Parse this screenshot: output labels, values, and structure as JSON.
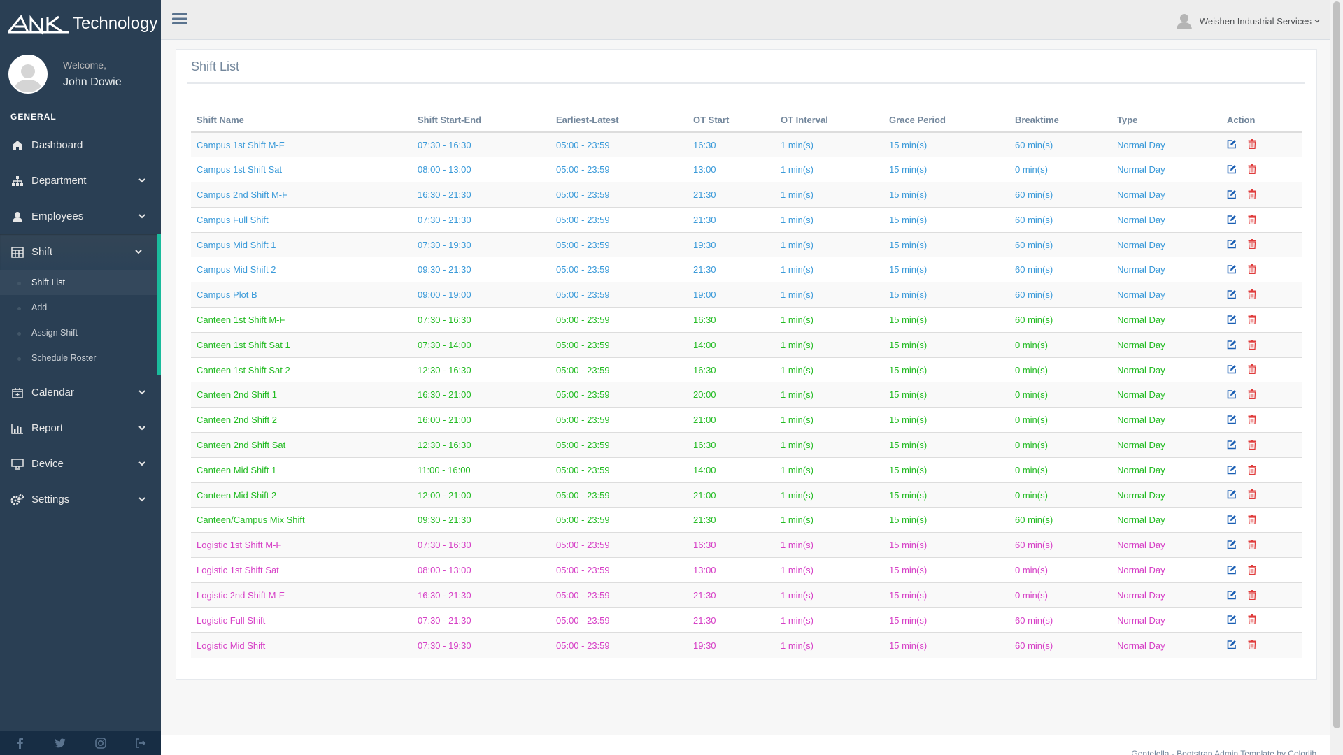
{
  "brand": {
    "name": "Technology"
  },
  "profile": {
    "welcome": "Welcome,",
    "name": "John Dowie"
  },
  "menu": {
    "section": "GENERAL",
    "items": [
      {
        "label": "Dashboard",
        "icon": "home-icon"
      },
      {
        "label": "Department",
        "icon": "sitemap-icon"
      },
      {
        "label": "Employees",
        "icon": "user-icon"
      },
      {
        "label": "Shift",
        "icon": "table-icon"
      },
      {
        "label": "Calendar",
        "icon": "calendar-plus-icon"
      },
      {
        "label": "Report",
        "icon": "bar-chart-icon"
      },
      {
        "label": "Device",
        "icon": "desktop-icon"
      },
      {
        "label": "Settings",
        "icon": "cogs-icon"
      }
    ],
    "shift_submenu": [
      "Shift List",
      "Add",
      "Assign Shift",
      "Schedule Roster"
    ]
  },
  "topnav": {
    "user": "Weishen Industrial Services"
  },
  "panel": {
    "title": "Shift List"
  },
  "table": {
    "headers": [
      "Shift Name",
      "Shift Start-End",
      "Earliest-Latest",
      "OT Start",
      "OT Interval",
      "Grace Period",
      "Breaktime",
      "Type",
      "Action"
    ],
    "rows": [
      {
        "name": "Campus 1st Shift M-F",
        "start_end": "07:30 - 16:30",
        "earliest_latest": "05:00 - 23:59",
        "ot_start": "16:30",
        "ot_interval": "1 min(s)",
        "grace": "15 min(s)",
        "breaktime": "60 min(s)",
        "type": "Normal Day",
        "color": "#3a9ad9"
      },
      {
        "name": "Campus 1st Shift Sat",
        "start_end": "08:00 - 13:00",
        "earliest_latest": "05:00 - 23:59",
        "ot_start": "13:00",
        "ot_interval": "1 min(s)",
        "grace": "15 min(s)",
        "breaktime": "0 min(s)",
        "type": "Normal Day",
        "color": "#3a9ad9"
      },
      {
        "name": "Campus 2nd Shift M-F",
        "start_end": "16:30 - 21:30",
        "earliest_latest": "05:00 - 23:59",
        "ot_start": "21:30",
        "ot_interval": "1 min(s)",
        "grace": "15 min(s)",
        "breaktime": "60 min(s)",
        "type": "Normal Day",
        "color": "#3a9ad9"
      },
      {
        "name": "Campus Full Shift",
        "start_end": "07:30 - 21:30",
        "earliest_latest": "05:00 - 23:59",
        "ot_start": "21:30",
        "ot_interval": "1 min(s)",
        "grace": "15 min(s)",
        "breaktime": "60 min(s)",
        "type": "Normal Day",
        "color": "#3a9ad9"
      },
      {
        "name": "Campus Mid Shift 1",
        "start_end": "07:30 - 19:30",
        "earliest_latest": "05:00 - 23:59",
        "ot_start": "19:30",
        "ot_interval": "1 min(s)",
        "grace": "15 min(s)",
        "breaktime": "60 min(s)",
        "type": "Normal Day",
        "color": "#3a9ad9"
      },
      {
        "name": "Campus Mid Shift 2",
        "start_end": "09:30 - 21:30",
        "earliest_latest": "05:00 - 23:59",
        "ot_start": "21:30",
        "ot_interval": "1 min(s)",
        "grace": "15 min(s)",
        "breaktime": "60 min(s)",
        "type": "Normal Day",
        "color": "#3a9ad9"
      },
      {
        "name": "Campus Plot B",
        "start_end": "09:00 - 19:00",
        "earliest_latest": "05:00 - 23:59",
        "ot_start": "19:00",
        "ot_interval": "1 min(s)",
        "grace": "15 min(s)",
        "breaktime": "60 min(s)",
        "type": "Normal Day",
        "color": "#3a9ad9"
      },
      {
        "name": "Canteen 1st Shift M-F",
        "start_end": "07:30 - 16:30",
        "earliest_latest": "05:00 - 23:59",
        "ot_start": "16:30",
        "ot_interval": "1 min(s)",
        "grace": "15 min(s)",
        "breaktime": "60 min(s)",
        "type": "Normal Day",
        "color": "#22bb22"
      },
      {
        "name": "Canteen 1st Shift Sat 1",
        "start_end": "07:30 - 14:00",
        "earliest_latest": "05:00 - 23:59",
        "ot_start": "14:00",
        "ot_interval": "1 min(s)",
        "grace": "15 min(s)",
        "breaktime": "0 min(s)",
        "type": "Normal Day",
        "color": "#22bb22"
      },
      {
        "name": "Canteen 1st Shift Sat 2",
        "start_end": "12:30 - 16:30",
        "earliest_latest": "05:00 - 23:59",
        "ot_start": "16:30",
        "ot_interval": "1 min(s)",
        "grace": "15 min(s)",
        "breaktime": "0 min(s)",
        "type": "Normal Day",
        "color": "#22bb22"
      },
      {
        "name": "Canteen 2nd Shift 1",
        "start_end": "16:30 - 21:00",
        "earliest_latest": "05:00 - 23:59",
        "ot_start": "20:00",
        "ot_interval": "1 min(s)",
        "grace": "15 min(s)",
        "breaktime": "0 min(s)",
        "type": "Normal Day",
        "color": "#22bb22"
      },
      {
        "name": "Canteen 2nd Shift 2",
        "start_end": "16:00 - 21:00",
        "earliest_latest": "05:00 - 23:59",
        "ot_start": "21:00",
        "ot_interval": "1 min(s)",
        "grace": "15 min(s)",
        "breaktime": "0 min(s)",
        "type": "Normal Day",
        "color": "#22bb22"
      },
      {
        "name": "Canteen 2nd Shift Sat",
        "start_end": "12:30 - 16:30",
        "earliest_latest": "05:00 - 23:59",
        "ot_start": "16:30",
        "ot_interval": "1 min(s)",
        "grace": "15 min(s)",
        "breaktime": "0 min(s)",
        "type": "Normal Day",
        "color": "#22bb22"
      },
      {
        "name": "Canteen Mid Shift 1",
        "start_end": "11:00 - 16:00",
        "earliest_latest": "05:00 - 23:59",
        "ot_start": "14:00",
        "ot_interval": "1 min(s)",
        "grace": "15 min(s)",
        "breaktime": "0 min(s)",
        "type": "Normal Day",
        "color": "#22bb22"
      },
      {
        "name": "Canteen Mid Shift 2",
        "start_end": "12:00 - 21:00",
        "earliest_latest": "05:00 - 23:59",
        "ot_start": "21:00",
        "ot_interval": "1 min(s)",
        "grace": "15 min(s)",
        "breaktime": "0 min(s)",
        "type": "Normal Day",
        "color": "#22bb22"
      },
      {
        "name": "Canteen/Campus Mix Shift",
        "start_end": "09:30 - 21:30",
        "earliest_latest": "05:00 - 23:59",
        "ot_start": "21:30",
        "ot_interval": "1 min(s)",
        "grace": "15 min(s)",
        "breaktime": "60 min(s)",
        "type": "Normal Day",
        "color": "#22bb22"
      },
      {
        "name": "Logistic 1st Shift M-F",
        "start_end": "07:30 - 16:30",
        "earliest_latest": "05:00 - 23:59",
        "ot_start": "16:30",
        "ot_interval": "1 min(s)",
        "grace": "15 min(s)",
        "breaktime": "60 min(s)",
        "type": "Normal Day",
        "color": "#d63fc6"
      },
      {
        "name": "Logistic 1st Shift Sat",
        "start_end": "08:00 - 13:00",
        "earliest_latest": "05:00 - 23:59",
        "ot_start": "13:00",
        "ot_interval": "1 min(s)",
        "grace": "15 min(s)",
        "breaktime": "0 min(s)",
        "type": "Normal Day",
        "color": "#d63fc6"
      },
      {
        "name": "Logistic 2nd Shift M-F",
        "start_end": "16:30 - 21:30",
        "earliest_latest": "05:00 - 23:59",
        "ot_start": "21:30",
        "ot_interval": "1 min(s)",
        "grace": "15 min(s)",
        "breaktime": "0 min(s)",
        "type": "Normal Day",
        "color": "#d63fc6"
      },
      {
        "name": "Logistic Full Shift",
        "start_end": "07:30 - 21:30",
        "earliest_latest": "05:00 - 23:59",
        "ot_start": "21:30",
        "ot_interval": "1 min(s)",
        "grace": "15 min(s)",
        "breaktime": "60 min(s)",
        "type": "Normal Day",
        "color": "#d63fc6"
      },
      {
        "name": "Logistic Mid Shift",
        "start_end": "07:30 - 19:30",
        "earliest_latest": "05:00 - 23:59",
        "ot_start": "19:30",
        "ot_interval": "1 min(s)",
        "grace": "15 min(s)",
        "breaktime": "60 min(s)",
        "type": "Normal Day",
        "color": "#d63fc6"
      }
    ]
  },
  "colors": {
    "sidebar": "#2a3f54",
    "accent": "#1abb9c",
    "edit": "#1a5fb4",
    "delete": "#e03c3c"
  },
  "footer": {
    "text": "Gentelella - Bootstrap Admin Template by Colorlib"
  }
}
